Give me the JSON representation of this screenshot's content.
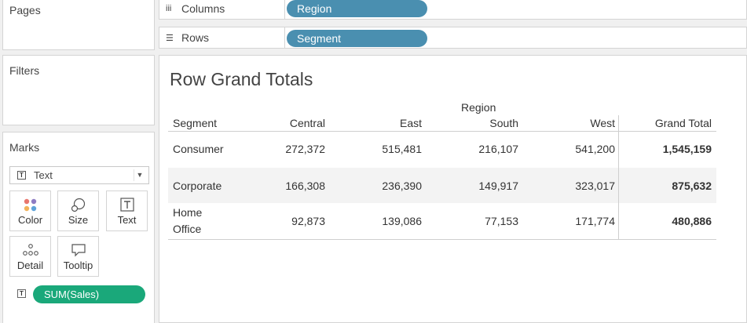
{
  "panels": {
    "pages": "Pages",
    "filters": "Filters",
    "marks": "Marks"
  },
  "marks": {
    "type": "Text",
    "buttons": {
      "color": "Color",
      "size": "Size",
      "text": "Text",
      "detail": "Detail",
      "tooltip": "Tooltip"
    },
    "field": "SUM(Sales)"
  },
  "shelves": {
    "columns_label": "Columns",
    "columns_pill": "Region",
    "rows_label": "Rows",
    "rows_pill": "Segment"
  },
  "view": {
    "title": "Row Grand Totals",
    "column_group_header": "Region",
    "row_header": "Segment",
    "columns": [
      "Central",
      "East",
      "South",
      "West",
      "Grand Total"
    ],
    "rows": [
      {
        "segment_line1": "Consumer",
        "segment_line2": "",
        "values": [
          "272,372",
          "515,481",
          "216,107",
          "541,200"
        ],
        "total": "1,545,159"
      },
      {
        "segment_line1": "Corporate",
        "segment_line2": "",
        "values": [
          "166,308",
          "236,390",
          "149,917",
          "323,017"
        ],
        "total": "875,632"
      },
      {
        "segment_line1": "Home",
        "segment_line2": "Office",
        "values": [
          "92,873",
          "139,086",
          "77,153",
          "171,774"
        ],
        "total": "480,886"
      }
    ]
  },
  "colors": {
    "dimension_pill": "#4a8fb0",
    "measure_pill": "#1aa87a",
    "alt_row": "#f3f3f3"
  }
}
